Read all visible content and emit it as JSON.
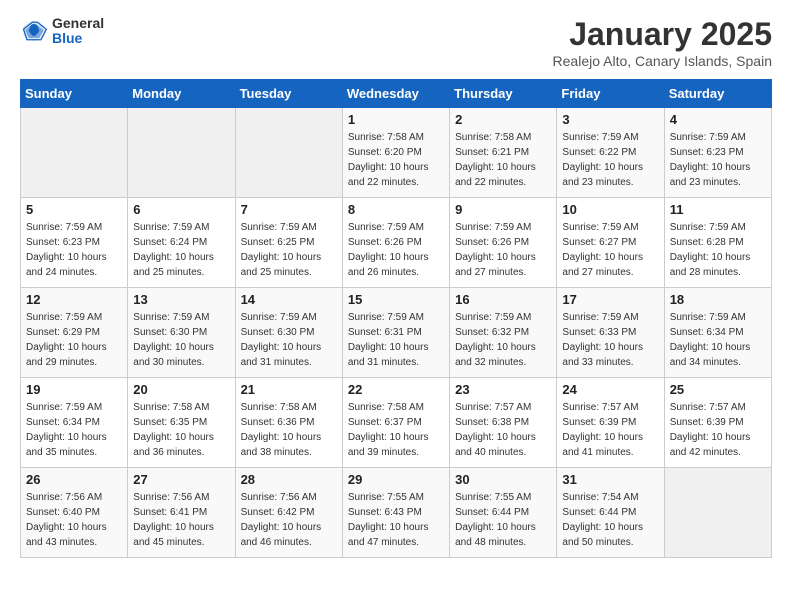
{
  "header": {
    "logo_general": "General",
    "logo_blue": "Blue",
    "month_title": "January 2025",
    "location": "Realejo Alto, Canary Islands, Spain"
  },
  "days_of_week": [
    "Sunday",
    "Monday",
    "Tuesday",
    "Wednesday",
    "Thursday",
    "Friday",
    "Saturday"
  ],
  "weeks": [
    [
      {
        "num": "",
        "info": ""
      },
      {
        "num": "",
        "info": ""
      },
      {
        "num": "",
        "info": ""
      },
      {
        "num": "1",
        "info": "Sunrise: 7:58 AM\nSunset: 6:20 PM\nDaylight: 10 hours\nand 22 minutes."
      },
      {
        "num": "2",
        "info": "Sunrise: 7:58 AM\nSunset: 6:21 PM\nDaylight: 10 hours\nand 22 minutes."
      },
      {
        "num": "3",
        "info": "Sunrise: 7:59 AM\nSunset: 6:22 PM\nDaylight: 10 hours\nand 23 minutes."
      },
      {
        "num": "4",
        "info": "Sunrise: 7:59 AM\nSunset: 6:23 PM\nDaylight: 10 hours\nand 23 minutes."
      }
    ],
    [
      {
        "num": "5",
        "info": "Sunrise: 7:59 AM\nSunset: 6:23 PM\nDaylight: 10 hours\nand 24 minutes."
      },
      {
        "num": "6",
        "info": "Sunrise: 7:59 AM\nSunset: 6:24 PM\nDaylight: 10 hours\nand 25 minutes."
      },
      {
        "num": "7",
        "info": "Sunrise: 7:59 AM\nSunset: 6:25 PM\nDaylight: 10 hours\nand 25 minutes."
      },
      {
        "num": "8",
        "info": "Sunrise: 7:59 AM\nSunset: 6:26 PM\nDaylight: 10 hours\nand 26 minutes."
      },
      {
        "num": "9",
        "info": "Sunrise: 7:59 AM\nSunset: 6:26 PM\nDaylight: 10 hours\nand 27 minutes."
      },
      {
        "num": "10",
        "info": "Sunrise: 7:59 AM\nSunset: 6:27 PM\nDaylight: 10 hours\nand 27 minutes."
      },
      {
        "num": "11",
        "info": "Sunrise: 7:59 AM\nSunset: 6:28 PM\nDaylight: 10 hours\nand 28 minutes."
      }
    ],
    [
      {
        "num": "12",
        "info": "Sunrise: 7:59 AM\nSunset: 6:29 PM\nDaylight: 10 hours\nand 29 minutes."
      },
      {
        "num": "13",
        "info": "Sunrise: 7:59 AM\nSunset: 6:30 PM\nDaylight: 10 hours\nand 30 minutes."
      },
      {
        "num": "14",
        "info": "Sunrise: 7:59 AM\nSunset: 6:30 PM\nDaylight: 10 hours\nand 31 minutes."
      },
      {
        "num": "15",
        "info": "Sunrise: 7:59 AM\nSunset: 6:31 PM\nDaylight: 10 hours\nand 31 minutes."
      },
      {
        "num": "16",
        "info": "Sunrise: 7:59 AM\nSunset: 6:32 PM\nDaylight: 10 hours\nand 32 minutes."
      },
      {
        "num": "17",
        "info": "Sunrise: 7:59 AM\nSunset: 6:33 PM\nDaylight: 10 hours\nand 33 minutes."
      },
      {
        "num": "18",
        "info": "Sunrise: 7:59 AM\nSunset: 6:34 PM\nDaylight: 10 hours\nand 34 minutes."
      }
    ],
    [
      {
        "num": "19",
        "info": "Sunrise: 7:59 AM\nSunset: 6:34 PM\nDaylight: 10 hours\nand 35 minutes."
      },
      {
        "num": "20",
        "info": "Sunrise: 7:58 AM\nSunset: 6:35 PM\nDaylight: 10 hours\nand 36 minutes."
      },
      {
        "num": "21",
        "info": "Sunrise: 7:58 AM\nSunset: 6:36 PM\nDaylight: 10 hours\nand 38 minutes."
      },
      {
        "num": "22",
        "info": "Sunrise: 7:58 AM\nSunset: 6:37 PM\nDaylight: 10 hours\nand 39 minutes."
      },
      {
        "num": "23",
        "info": "Sunrise: 7:57 AM\nSunset: 6:38 PM\nDaylight: 10 hours\nand 40 minutes."
      },
      {
        "num": "24",
        "info": "Sunrise: 7:57 AM\nSunset: 6:39 PM\nDaylight: 10 hours\nand 41 minutes."
      },
      {
        "num": "25",
        "info": "Sunrise: 7:57 AM\nSunset: 6:39 PM\nDaylight: 10 hours\nand 42 minutes."
      }
    ],
    [
      {
        "num": "26",
        "info": "Sunrise: 7:56 AM\nSunset: 6:40 PM\nDaylight: 10 hours\nand 43 minutes."
      },
      {
        "num": "27",
        "info": "Sunrise: 7:56 AM\nSunset: 6:41 PM\nDaylight: 10 hours\nand 45 minutes."
      },
      {
        "num": "28",
        "info": "Sunrise: 7:56 AM\nSunset: 6:42 PM\nDaylight: 10 hours\nand 46 minutes."
      },
      {
        "num": "29",
        "info": "Sunrise: 7:55 AM\nSunset: 6:43 PM\nDaylight: 10 hours\nand 47 minutes."
      },
      {
        "num": "30",
        "info": "Sunrise: 7:55 AM\nSunset: 6:44 PM\nDaylight: 10 hours\nand 48 minutes."
      },
      {
        "num": "31",
        "info": "Sunrise: 7:54 AM\nSunset: 6:44 PM\nDaylight: 10 hours\nand 50 minutes."
      },
      {
        "num": "",
        "info": ""
      }
    ]
  ]
}
